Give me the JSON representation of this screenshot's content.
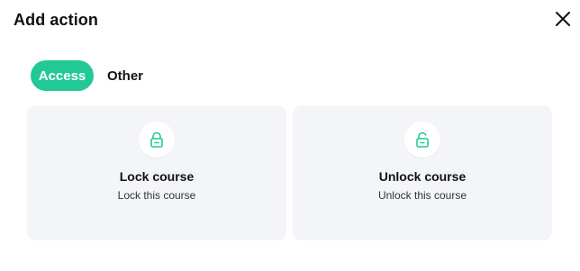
{
  "dialog": {
    "title": "Add action",
    "close_icon": "close-icon"
  },
  "tabs": [
    {
      "label": "Access",
      "active": true
    },
    {
      "label": "Other",
      "active": false
    }
  ],
  "cards": [
    {
      "icon": "lock-icon",
      "title": "Lock course",
      "subtitle": "Lock this course"
    },
    {
      "icon": "unlock-icon",
      "title": "Unlock course",
      "subtitle": "Unlock this course"
    }
  ],
  "colors": {
    "accent": "#22c997",
    "card_background": "#f3f5f9"
  }
}
